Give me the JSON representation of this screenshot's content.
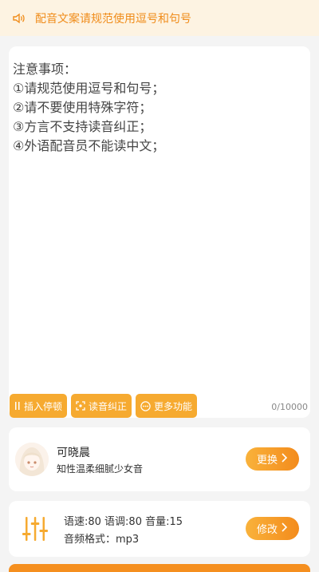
{
  "notice": {
    "text": "配音文案请规范使用逗号和句号"
  },
  "editor": {
    "content": "注意事项：\n①请规范使用逗号和句号；\n②请不要使用特殊字符；\n③方言不支持读音纠正；\n④外语配音员不能读中文；",
    "counter": "0/10000",
    "tools": [
      {
        "label": "插入停顿",
        "icon": "pause-icon"
      },
      {
        "label": "读音纠正",
        "icon": "correct-icon"
      },
      {
        "label": "更多功能",
        "icon": "more-icon"
      }
    ]
  },
  "voice": {
    "name": "可晓晨",
    "description": "知性温柔细腻少女音",
    "change_label": "更换"
  },
  "params": {
    "line1": "语速:80 语调:80 音量:15",
    "line2": "音频格式：mp3",
    "edit_label": "修改"
  },
  "colors": {
    "accent": "#f6aa30",
    "notice_bg": "#fdf3e2",
    "notice_text": "#f08c1a"
  }
}
